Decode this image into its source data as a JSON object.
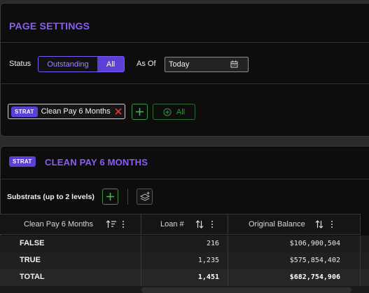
{
  "page_settings": {
    "title": "PAGE SETTINGS",
    "status_label": "Status",
    "status_options": [
      "Outstanding",
      "All"
    ],
    "status_selected": "All",
    "as_of_label": "As Of",
    "as_of_value": "Today",
    "filter_chip": {
      "badge": "STRAT",
      "label": "Clean Pay 6 Months"
    },
    "all_button_label": "All"
  },
  "strat": {
    "badge": "STRAT",
    "title": "CLEAN PAY 6 MONTHS",
    "substrats_label": "Substrats (up to 2 levels)",
    "columns": [
      "Clean Pay 6 Months",
      "Loan #",
      "Original Balance"
    ],
    "rows": [
      {
        "name": "FALSE",
        "loan_count": "216",
        "original_balance": "$106,900,504"
      },
      {
        "name": "TRUE",
        "loan_count": "1,235",
        "original_balance": "$575,854,402"
      },
      {
        "name": "TOTAL",
        "loan_count": "1,451",
        "original_balance": "$682,754,906"
      }
    ]
  },
  "colors": {
    "accent": "#8b5cf6",
    "badge": "#5b3fd6",
    "green": "#4caf50",
    "remove": "#e53935"
  }
}
